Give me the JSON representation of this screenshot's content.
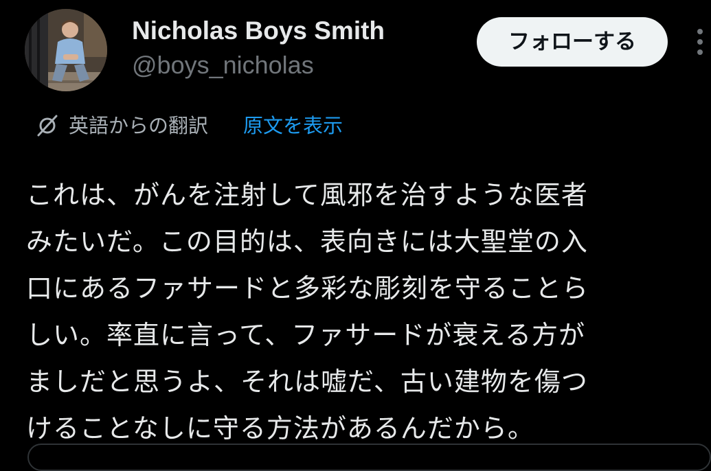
{
  "author": {
    "name": "Nicholas Boys Smith",
    "handle": "@boys_nicholas",
    "avatar_icon": "profile-photo"
  },
  "follow_button": {
    "label": "フォローする"
  },
  "more_button": {
    "icon": "vertical-ellipsis-icon"
  },
  "translation": {
    "icon": "translate-icon",
    "label": "英語からの翻訳",
    "show_original_label": "原文を表示"
  },
  "tweet": {
    "text": "これは、がんを注射して風邪を治すような医者\nみたいだ。この目的は、表向きには大聖堂の入\n口にあるファサードと多彩な彫刻を守ることら\nしい。率直に言って、ファサードが衰える方が\nましだと思うよ、それは嘘だ、古い建物を傷つ\nけることなしに守る方法があるんだから。"
  },
  "colors": {
    "background": "#000000",
    "primary_text": "#e7e9ea",
    "secondary_text": "#71767b",
    "link": "#1d9bf0",
    "follow_button_bg": "#eff3f4"
  }
}
